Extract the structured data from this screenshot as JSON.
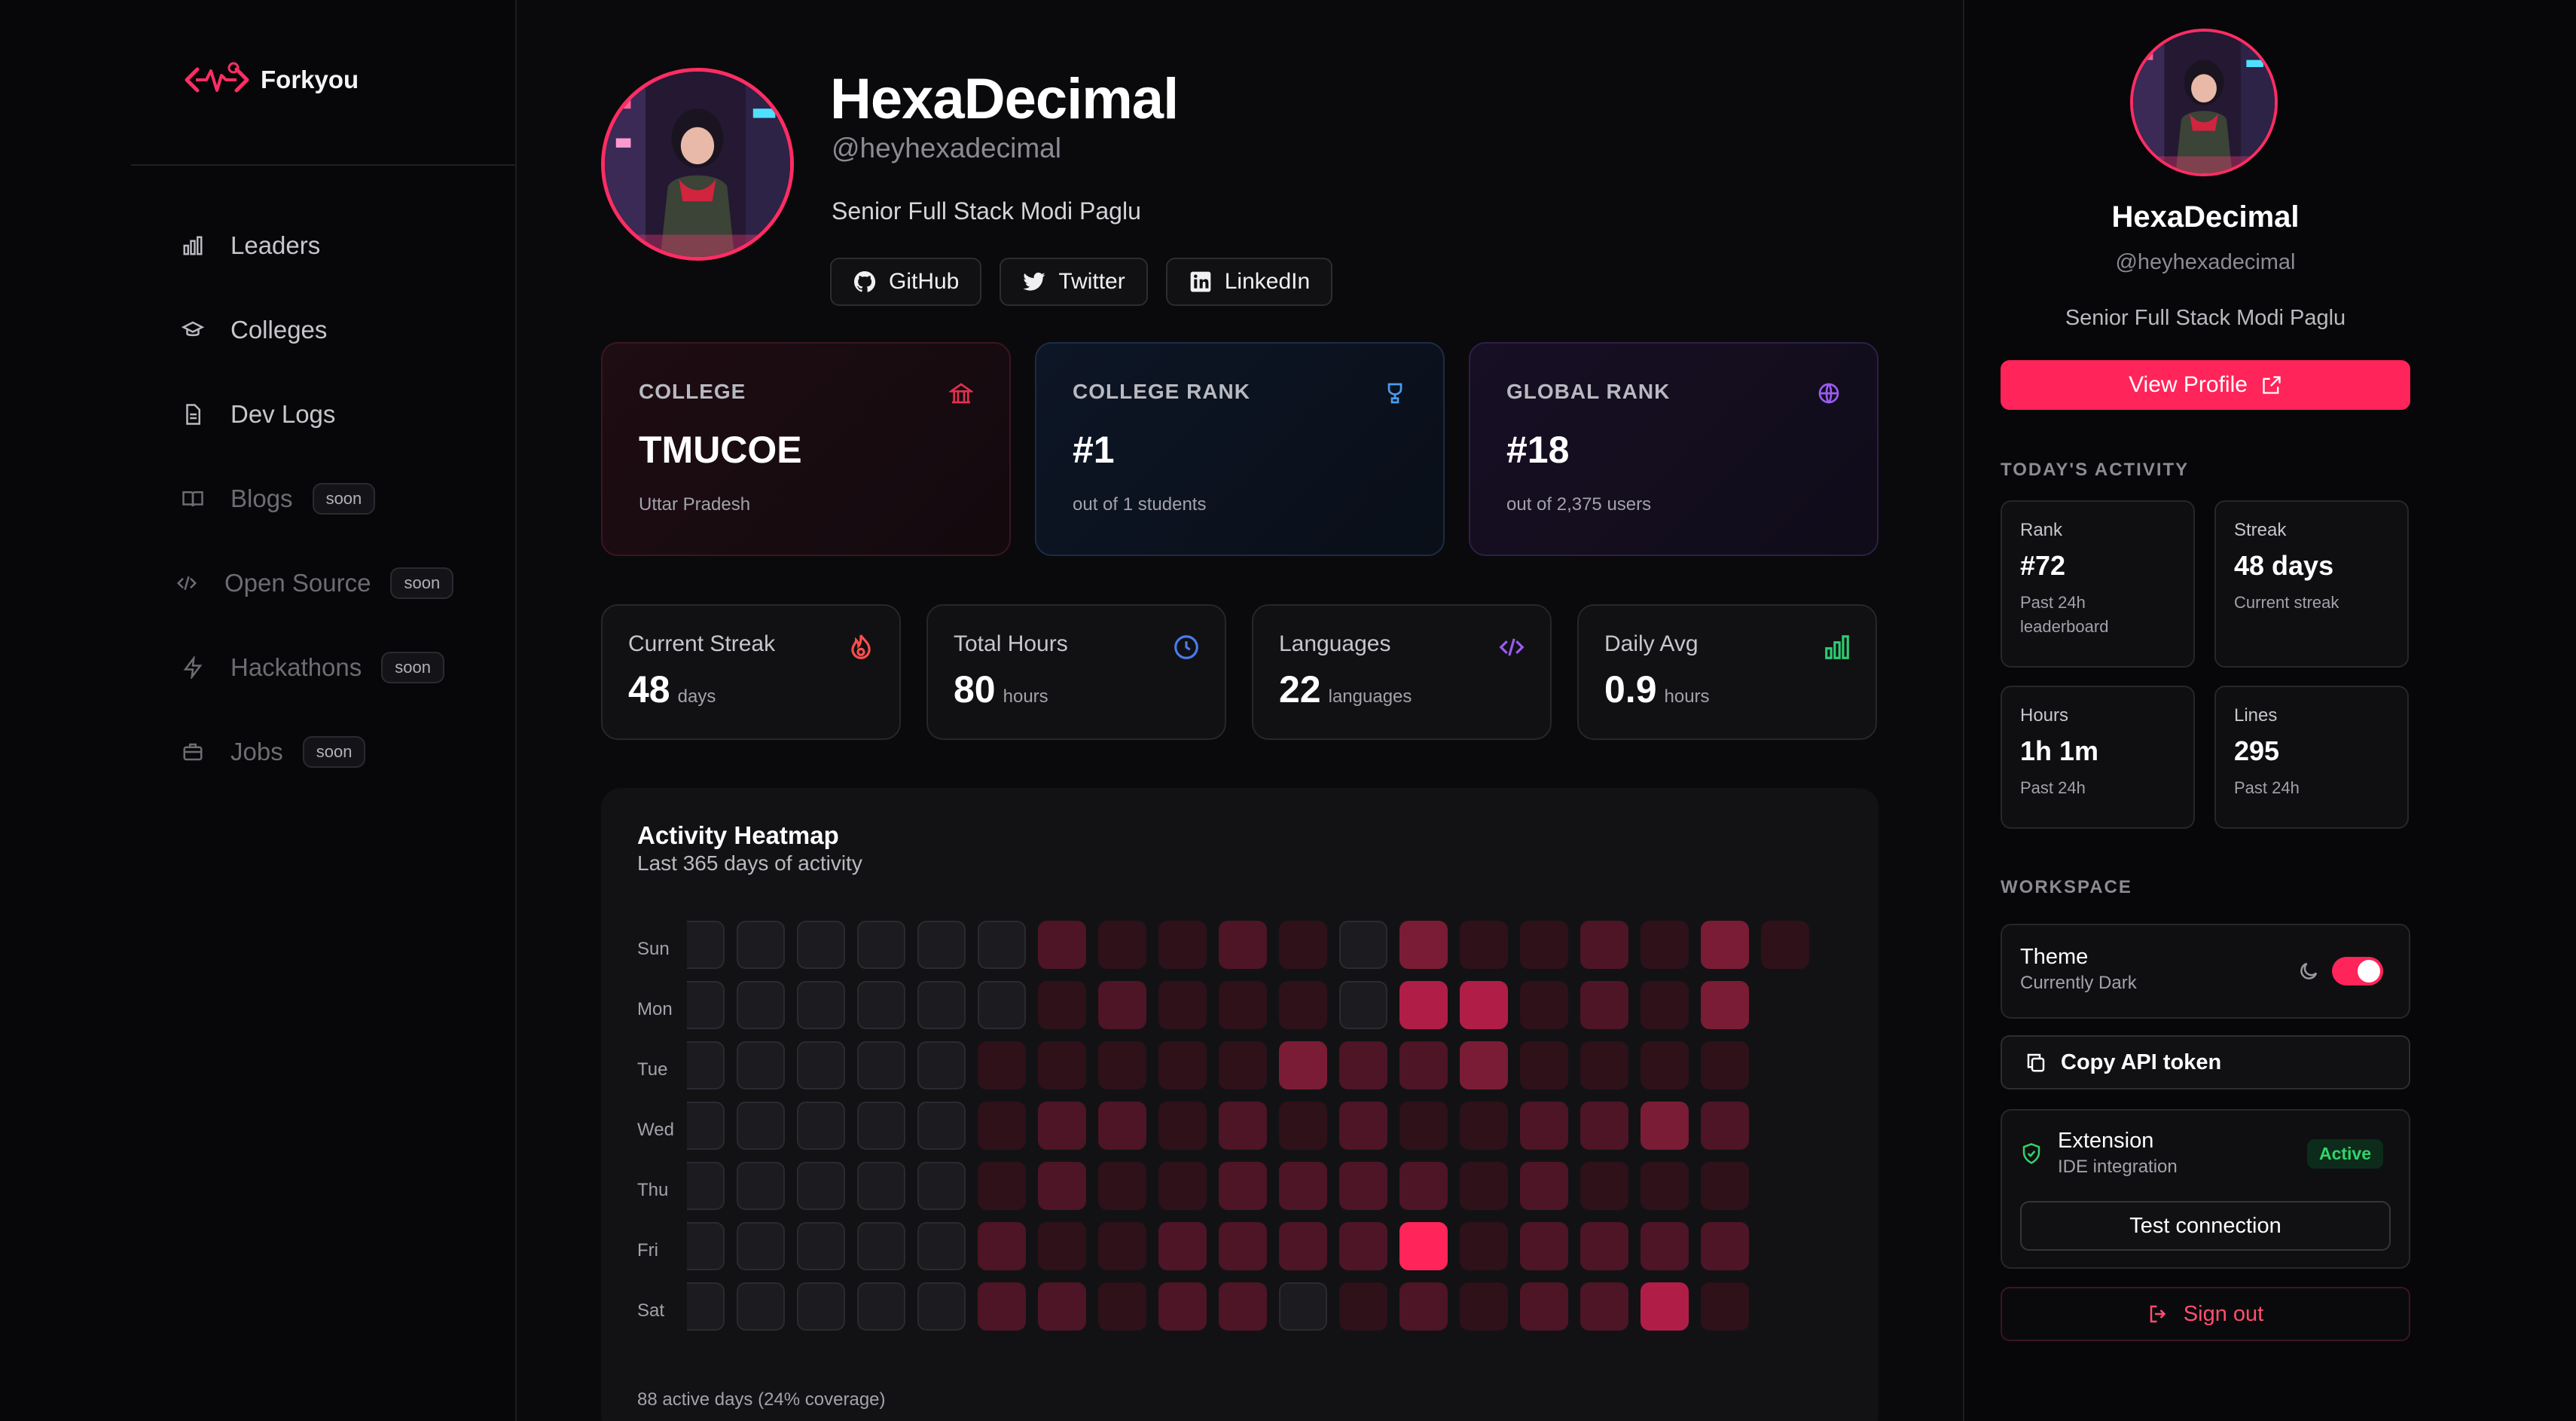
{
  "brand": {
    "name": "Forkyou"
  },
  "nav": [
    {
      "label": "Leaders",
      "icon": "bar-chart-icon",
      "soon": ""
    },
    {
      "label": "Colleges",
      "icon": "graduation-cap-icon",
      "soon": ""
    },
    {
      "label": "Dev Logs",
      "icon": "file-text-icon",
      "soon": ""
    },
    {
      "label": "Blogs",
      "icon": "book-icon",
      "soon": "soon"
    },
    {
      "label": "Open Source",
      "icon": "code-icon",
      "soon": "soon"
    },
    {
      "label": "Hackathons",
      "icon": "bolt-icon",
      "soon": "soon"
    },
    {
      "label": "Jobs",
      "icon": "briefcase-icon",
      "soon": "soon"
    }
  ],
  "profile": {
    "name": "HexaDecimal",
    "handle": "@heyhexadecimal",
    "bio": "Senior Full Stack Modi Paglu",
    "socials": [
      {
        "label": "GitHub",
        "icon": "github-icon"
      },
      {
        "label": "Twitter",
        "icon": "twitter-icon"
      },
      {
        "label": "LinkedIn",
        "icon": "linkedin-icon"
      }
    ]
  },
  "rank_cards": [
    {
      "label": "COLLEGE",
      "value": "TMUCOE",
      "sub": "Uttar Pradesh",
      "icon": "building-icon",
      "color": "#e0304f"
    },
    {
      "label": "COLLEGE RANK",
      "value": "#1",
      "sub": "out of 1 students",
      "icon": "trophy-icon",
      "color": "#4a9cf0"
    },
    {
      "label": "GLOBAL RANK",
      "value": "#18",
      "sub": "out of 2,375 users",
      "icon": "globe-icon",
      "color": "#9b5cf0"
    }
  ],
  "stats": [
    {
      "label": "Current Streak",
      "value": "48",
      "unit": "days",
      "icon": "flame-icon",
      "color": "#ff4e4e"
    },
    {
      "label": "Total Hours",
      "value": "80",
      "unit": "hours",
      "icon": "clock-icon",
      "color": "#4a7cf0"
    },
    {
      "label": "Languages",
      "value": "22",
      "unit": "languages",
      "icon": "code-icon",
      "color": "#9b5cf0"
    },
    {
      "label": "Daily Avg",
      "value": "0.9",
      "unit": "hours",
      "icon": "bar-chart-icon",
      "color": "#2ecc71"
    }
  ],
  "heatmap": {
    "title": "Activity Heatmap",
    "subtitle": "Last 365 days of activity",
    "days": [
      "Sun",
      "Mon",
      "Tue",
      "Wed",
      "Thu",
      "Fri",
      "Sat"
    ],
    "footer": "88 active days (24% coverage)",
    "levels": [
      [
        0,
        0,
        0,
        0,
        0,
        0,
        2,
        1,
        1,
        2,
        1,
        0,
        3,
        1,
        1,
        2,
        1,
        3,
        1
      ],
      [
        0,
        0,
        0,
        0,
        0,
        0,
        1,
        2,
        1,
        1,
        1,
        0,
        4,
        4,
        1,
        2,
        1,
        3
      ],
      [
        0,
        0,
        0,
        0,
        0,
        1,
        1,
        1,
        1,
        1,
        3,
        2,
        2,
        3,
        1,
        1,
        1,
        1
      ],
      [
        0,
        0,
        0,
        0,
        0,
        1,
        2,
        2,
        1,
        2,
        1,
        2,
        1,
        1,
        2,
        2,
        3,
        2
      ],
      [
        0,
        0,
        0,
        0,
        0,
        1,
        2,
        1,
        1,
        2,
        2,
        2,
        2,
        1,
        2,
        1,
        1,
        1
      ],
      [
        0,
        0,
        0,
        0,
        0,
        2,
        1,
        1,
        2,
        2,
        2,
        2,
        5,
        1,
        2,
        2,
        2,
        2
      ],
      [
        0,
        0,
        0,
        0,
        0,
        2,
        2,
        1,
        2,
        2,
        0,
        1,
        2,
        1,
        2,
        2,
        4,
        1
      ]
    ],
    "palette": [
      "#1c1c20",
      "#2e1119",
      "#4d1525",
      "#7a1c35",
      "#b01e47",
      "#ff2459"
    ]
  },
  "right_panel": {
    "name": "HexaDecimal",
    "handle": "@heyhexadecimal",
    "bio": "Senior Full Stack Modi Paglu",
    "view_profile": "View Profile",
    "today_label": "TODAY'S ACTIVITY",
    "activity": [
      {
        "label": "Rank",
        "value": "#72",
        "sub": "Past 24h leaderboard"
      },
      {
        "label": "Streak",
        "value": "48 days",
        "sub": "Current streak"
      },
      {
        "label": "Hours",
        "value": "1h 1m",
        "sub": "Past 24h"
      },
      {
        "label": "Lines",
        "value": "295",
        "sub": "Past 24h"
      }
    ],
    "workspace_label": "WORKSPACE",
    "theme_title": "Theme",
    "theme_sub": "Currently Dark",
    "theme_on": true,
    "copy_token": "Copy API token",
    "ext_title": "Extension",
    "ext_sub": "IDE integration",
    "ext_status": "Active",
    "test_connection": "Test connection",
    "sign_out": "Sign out"
  }
}
